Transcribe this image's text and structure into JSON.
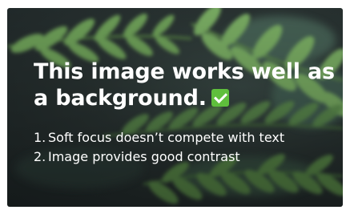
{
  "headline": {
    "line1": "This image works well as",
    "line2": "a background.",
    "check_icon": "white-heavy-check-mark-icon"
  },
  "points": [
    {
      "number": "1.",
      "text": "Soft focus doesn’t compete with text"
    },
    {
      "number": "2.",
      "text": "Image provides good contrast"
    }
  ],
  "colors": {
    "background_dark": "#1f2728",
    "leaf_green": "#6fa35a",
    "text": "#ffffff",
    "check_green": "#5fbf3c"
  }
}
